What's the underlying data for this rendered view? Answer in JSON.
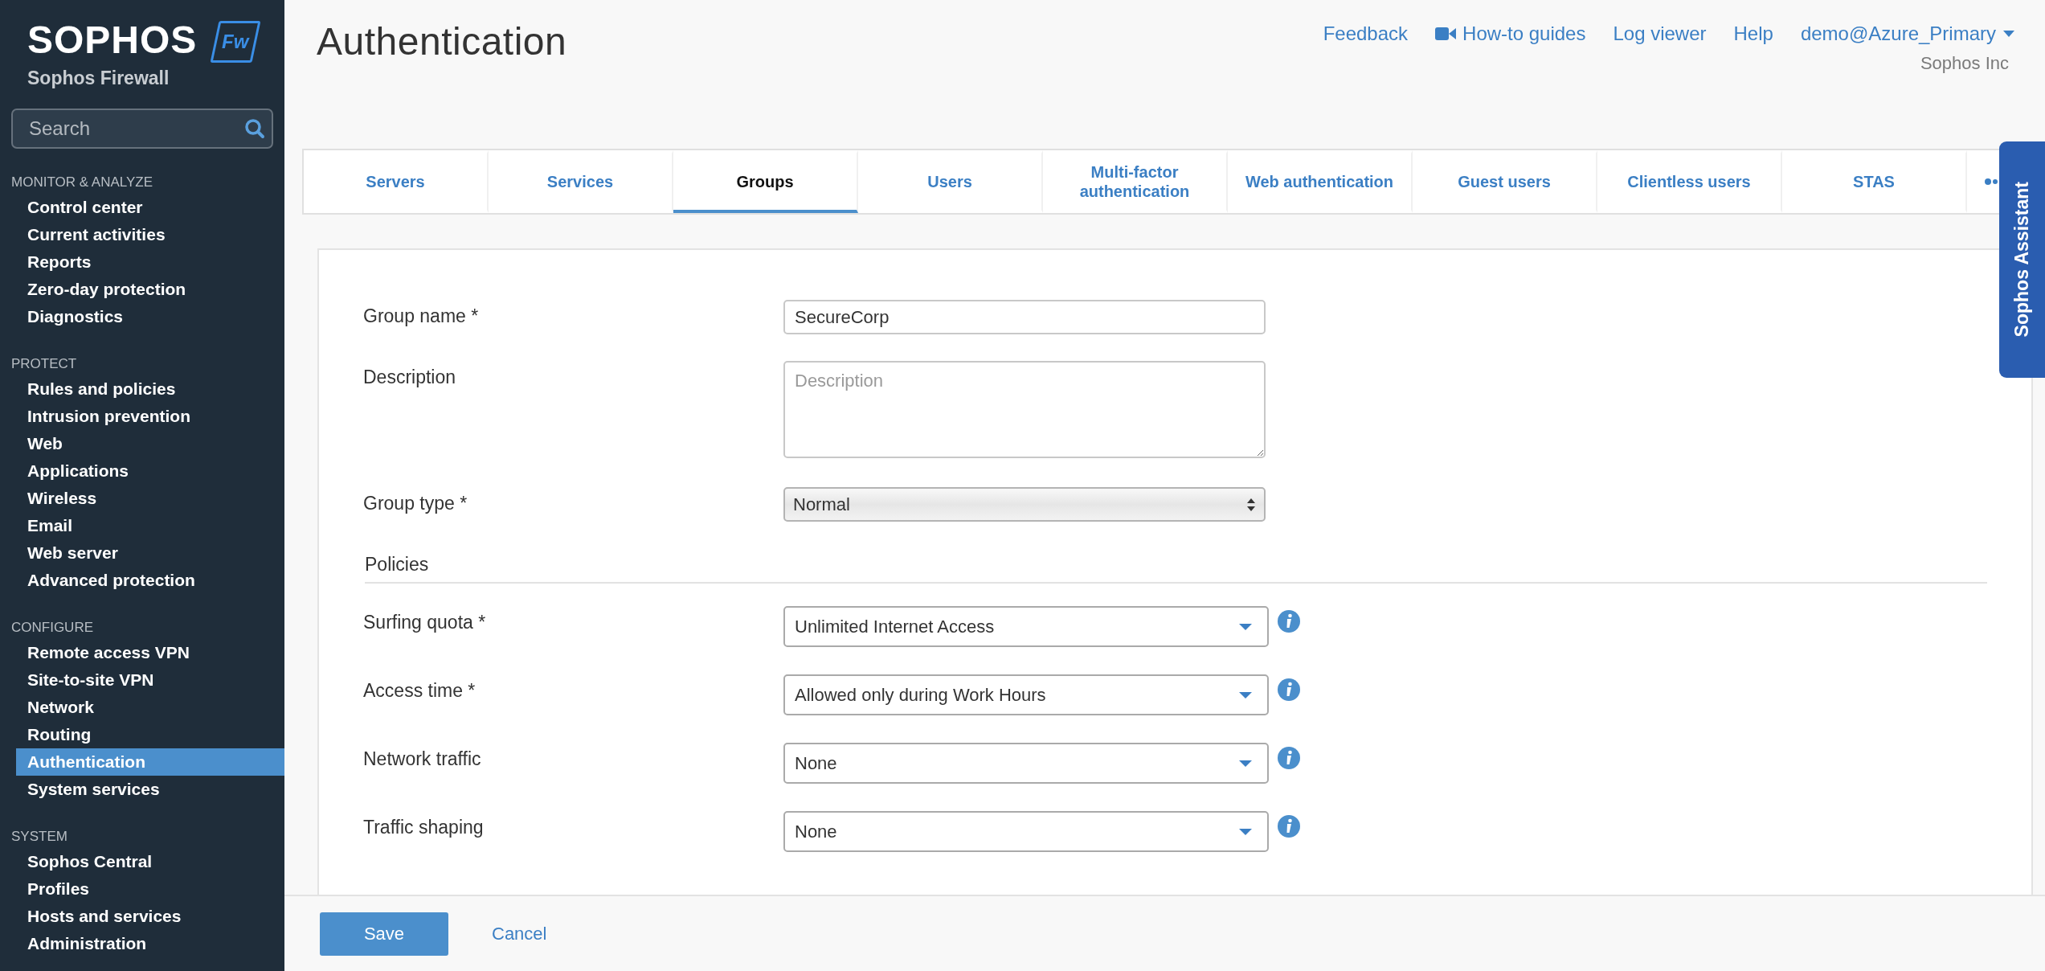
{
  "brand": {
    "name": "SOPHOS",
    "badge": "Fw",
    "product": "Sophos Firewall"
  },
  "search": {
    "placeholder": "Search"
  },
  "sidebar": {
    "sections": [
      {
        "heading": "MONITOR & ANALYZE",
        "items": [
          {
            "label": "Control center",
            "selected": false
          },
          {
            "label": "Current activities",
            "selected": false
          },
          {
            "label": "Reports",
            "selected": false
          },
          {
            "label": "Zero-day protection",
            "selected": false
          },
          {
            "label": "Diagnostics",
            "selected": false
          }
        ]
      },
      {
        "heading": "PROTECT",
        "items": [
          {
            "label": "Rules and policies",
            "selected": false
          },
          {
            "label": "Intrusion prevention",
            "selected": false
          },
          {
            "label": "Web",
            "selected": false
          },
          {
            "label": "Applications",
            "selected": false
          },
          {
            "label": "Wireless",
            "selected": false
          },
          {
            "label": "Email",
            "selected": false
          },
          {
            "label": "Web server",
            "selected": false
          },
          {
            "label": "Advanced protection",
            "selected": false
          }
        ]
      },
      {
        "heading": "CONFIGURE",
        "items": [
          {
            "label": "Remote access VPN",
            "selected": false
          },
          {
            "label": "Site-to-site VPN",
            "selected": false
          },
          {
            "label": "Network",
            "selected": false
          },
          {
            "label": "Routing",
            "selected": false
          },
          {
            "label": "Authentication",
            "selected": true
          },
          {
            "label": "System services",
            "selected": false
          }
        ]
      },
      {
        "heading": "SYSTEM",
        "items": [
          {
            "label": "Sophos Central",
            "selected": false
          },
          {
            "label": "Profiles",
            "selected": false
          },
          {
            "label": "Hosts and services",
            "selected": false
          },
          {
            "label": "Administration",
            "selected": false
          }
        ]
      }
    ]
  },
  "page_title": "Authentication",
  "header_links": [
    {
      "label": "Feedback",
      "kind": "link"
    },
    {
      "label": "How-to guides",
      "kind": "video"
    },
    {
      "label": "Log viewer",
      "kind": "link"
    },
    {
      "label": "Help",
      "kind": "link"
    },
    {
      "label": "demo@Azure_Primary",
      "kind": "menu"
    }
  ],
  "organization": "Sophos Inc",
  "tabs": [
    {
      "label": "Servers",
      "selected": false
    },
    {
      "label": "Services",
      "selected": false
    },
    {
      "label": "Groups",
      "selected": true
    },
    {
      "label": "Users",
      "selected": false
    },
    {
      "label": "Multi-factor authentication",
      "selected": false
    },
    {
      "label": "Web authentication",
      "selected": false
    },
    {
      "label": "Guest users",
      "selected": false
    },
    {
      "label": "Clientless users",
      "selected": false
    },
    {
      "label": "STAS",
      "selected": false
    }
  ],
  "assistant": {
    "label": "Sophos Assistant"
  },
  "form": {
    "fields": [
      {
        "kind": "text",
        "label": "Group name *",
        "value": "SecureCorp"
      },
      {
        "kind": "textarea",
        "label": "Description",
        "placeholder": "Description"
      },
      {
        "kind": "select",
        "label": "Group type *",
        "value": "Normal"
      }
    ],
    "section": "Policies",
    "policies": [
      {
        "label": "Surfing quota *",
        "value": "Unlimited Internet Access"
      },
      {
        "label": "Access time *",
        "value": "Allowed only during Work Hours"
      },
      {
        "label": "Network traffic",
        "value": "None"
      },
      {
        "label": "Traffic shaping",
        "value": "None"
      }
    ]
  },
  "actions": {
    "save": "Save",
    "cancel": "Cancel"
  }
}
